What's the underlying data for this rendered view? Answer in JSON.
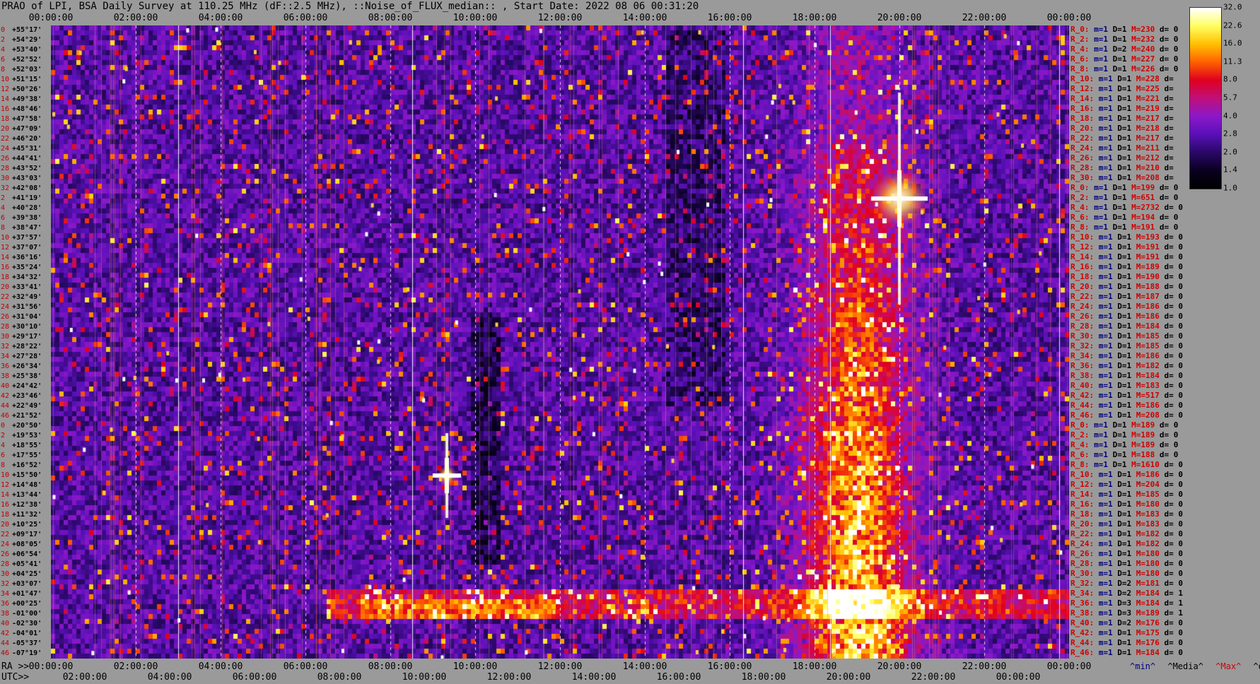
{
  "header": {
    "title": "PRAO of LPI, BSA Daily Survey at 110.25 MHz (dF::2.5 MHz), ::Noise_of_FLUX_median:: , Start Date: 2022 08 06 00:31:20"
  },
  "axes": {
    "ra_prefix": "RA >>",
    "utc_prefix": "UTC>>",
    "top_ticks": [
      "00:00:00",
      "02:00:00",
      "04:00:00",
      "06:00:00",
      "08:00:00",
      "10:00:00",
      "12:00:00",
      "14:00:00",
      "16:00:00",
      "18:00:00",
      "20:00:00",
      "22:00:00",
      "00:00:00"
    ],
    "ra_ticks": [
      "00:00:00",
      "02:00:00",
      "04:00:00",
      "06:00:00",
      "08:00:00",
      "10:00:00",
      "12:00:00",
      "14:00:00",
      "16:00:00",
      "18:00:00",
      "20:00:00",
      "22:00:00",
      "00:00:00"
    ],
    "utc_ticks": [
      "02:00:00",
      "04:00:00",
      "06:00:00",
      "08:00:00",
      "10:00:00",
      "12:00:00",
      "14:00:00",
      "16:00:00",
      "18:00:00",
      "20:00:00",
      "22:00:00",
      "00:00:00"
    ]
  },
  "rows": [
    {
      "idx": "0",
      "dec": "+55°17'"
    },
    {
      "idx": "2",
      "dec": "+54°29'"
    },
    {
      "idx": "4",
      "dec": "+53°40'"
    },
    {
      "idx": "6",
      "dec": "+52°52'"
    },
    {
      "idx": "8",
      "dec": "+52°03'"
    },
    {
      "idx": "10",
      "dec": "+51°15'"
    },
    {
      "idx": "12",
      "dec": "+50°26'"
    },
    {
      "idx": "14",
      "dec": "+49°38'"
    },
    {
      "idx": "16",
      "dec": "+48°46'"
    },
    {
      "idx": "18",
      "dec": "+47°58'"
    },
    {
      "idx": "20",
      "dec": "+47°09'"
    },
    {
      "idx": "22",
      "dec": "+46°20'"
    },
    {
      "idx": "24",
      "dec": "+45°31'"
    },
    {
      "idx": "26",
      "dec": "+44°41'"
    },
    {
      "idx": "28",
      "dec": "+43°52'"
    },
    {
      "idx": "30",
      "dec": "+43°03'"
    },
    {
      "idx": "32",
      "dec": "+42°08'"
    },
    {
      "idx": "2",
      "dec": "+41°19'"
    },
    {
      "idx": "4",
      "dec": "+40°28'"
    },
    {
      "idx": "6",
      "dec": "+39°38'"
    },
    {
      "idx": "8",
      "dec": "+38°47'"
    },
    {
      "idx": "10",
      "dec": "+37°57'"
    },
    {
      "idx": "12",
      "dec": "+37°07'"
    },
    {
      "idx": "14",
      "dec": "+36°16'"
    },
    {
      "idx": "16",
      "dec": "+35°24'"
    },
    {
      "idx": "18",
      "dec": "+34°32'"
    },
    {
      "idx": "20",
      "dec": "+33°41'"
    },
    {
      "idx": "22",
      "dec": "+32°49'"
    },
    {
      "idx": "24",
      "dec": "+31°56'"
    },
    {
      "idx": "26",
      "dec": "+31°04'"
    },
    {
      "idx": "28",
      "dec": "+30°10'"
    },
    {
      "idx": "30",
      "dec": "+29°17'"
    },
    {
      "idx": "32",
      "dec": "+28°22'"
    },
    {
      "idx": "34",
      "dec": "+27°28'"
    },
    {
      "idx": "36",
      "dec": "+26°34'"
    },
    {
      "idx": "38",
      "dec": "+25°38'"
    },
    {
      "idx": "40",
      "dec": "+24°42'"
    },
    {
      "idx": "42",
      "dec": "+23°46'"
    },
    {
      "idx": "44",
      "dec": "+22°49'"
    },
    {
      "idx": "46",
      "dec": "+21°52'"
    },
    {
      "idx": "0",
      "dec": "+20°50'"
    },
    {
      "idx": "2",
      "dec": "+19°53'"
    },
    {
      "idx": "4",
      "dec": "+18°55'"
    },
    {
      "idx": "6",
      "dec": "+17°55'"
    },
    {
      "idx": "8",
      "dec": "+16°52'"
    },
    {
      "idx": "10",
      "dec": "+15°50'"
    },
    {
      "idx": "12",
      "dec": "+14°48'"
    },
    {
      "idx": "14",
      "dec": "+13°44'"
    },
    {
      "idx": "16",
      "dec": "+12°38'"
    },
    {
      "idx": "18",
      "dec": "+11°32'"
    },
    {
      "idx": "20",
      "dec": "+10°25'"
    },
    {
      "idx": "22",
      "dec": "+09°17'"
    },
    {
      "idx": "24",
      "dec": "+08°05'"
    },
    {
      "idx": "26",
      "dec": "+06°54'"
    },
    {
      "idx": "28",
      "dec": "+05°41'"
    },
    {
      "idx": "30",
      "dec": "+04°25'"
    },
    {
      "idx": "32",
      "dec": "+03°07'"
    },
    {
      "idx": "34",
      "dec": "+01°47'"
    },
    {
      "idx": "36",
      "dec": "+00°25'"
    },
    {
      "idx": "38",
      "dec": "-01°00'"
    },
    {
      "idx": "40",
      "dec": "-02°30'"
    },
    {
      "idx": "42",
      "dec": "-04°01'"
    },
    {
      "idx": "44",
      "dec": "-05°37'"
    },
    {
      "idx": "46",
      "dec": "-07°19'"
    }
  ],
  "stats": [
    {
      "r": "R_0:",
      "m": "m=1",
      "d": "D=1",
      "M": "M=230",
      "dv": "d= 0"
    },
    {
      "r": "R_2:",
      "m": "m=1",
      "d": "D=1",
      "M": "M=232",
      "dv": "d= 0"
    },
    {
      "r": "R_4:",
      "m": "m=1",
      "d": "D=2",
      "M": "M=240",
      "dv": "d= 0"
    },
    {
      "r": "R_6:",
      "m": "m=1",
      "d": "D=1",
      "M": "M=227",
      "dv": "d= 0"
    },
    {
      "r": "R_8:",
      "m": "m=1",
      "d": "D=1",
      "M": "M=226",
      "dv": "d= 0"
    },
    {
      "r": "R_10:",
      "m": "m=1",
      "d": "D=1",
      "M": "M=228",
      "dv": "d="
    },
    {
      "r": "R_12:",
      "m": "m=1",
      "d": "D=1",
      "M": "M=225",
      "dv": "d="
    },
    {
      "r": "R_14:",
      "m": "m=1",
      "d": "D=1",
      "M": "M=221",
      "dv": "d="
    },
    {
      "r": "R_16:",
      "m": "m=1",
      "d": "D=1",
      "M": "M=219",
      "dv": "d="
    },
    {
      "r": "R_18:",
      "m": "m=1",
      "d": "D=1",
      "M": "M=217",
      "dv": "d="
    },
    {
      "r": "R_20:",
      "m": "m=1",
      "d": "D=1",
      "M": "M=218",
      "dv": "d="
    },
    {
      "r": "R_22:",
      "m": "m=1",
      "d": "D=1",
      "M": "M=217",
      "dv": "d="
    },
    {
      "r": "R_24:",
      "m": "m=1",
      "d": "D=1",
      "M": "M=211",
      "dv": "d="
    },
    {
      "r": "R_26:",
      "m": "m=1",
      "d": "D=1",
      "M": "M=212",
      "dv": "d="
    },
    {
      "r": "R_28:",
      "m": "m=1",
      "d": "D=1",
      "M": "M=210",
      "dv": "d="
    },
    {
      "r": "R_30:",
      "m": "m=1",
      "d": "D=1",
      "M": "M=208",
      "dv": "d="
    },
    {
      "r": "R_0:",
      "m": "m=1",
      "d": "D=1",
      "M": "M=199",
      "dv": "d= 0"
    },
    {
      "r": "R_2:",
      "m": "m=1",
      "d": "D=1",
      "M": "M=651",
      "dv": "d= 0"
    },
    {
      "r": "R_4:",
      "m": "m=1",
      "d": "D=1",
      "M": "M=2732",
      "dv": "d= 0"
    },
    {
      "r": "R_6:",
      "m": "m=1",
      "d": "D=1",
      "M": "M=194",
      "dv": "d= 0"
    },
    {
      "r": "R_8:",
      "m": "m=1",
      "d": "D=1",
      "M": "M=191",
      "dv": "d= 0"
    },
    {
      "r": "R_10:",
      "m": "m=1",
      "d": "D=1",
      "M": "M=193",
      "dv": "d= 0"
    },
    {
      "r": "R_12:",
      "m": "m=1",
      "d": "D=1",
      "M": "M=191",
      "dv": "d= 0"
    },
    {
      "r": "R_14:",
      "m": "m=1",
      "d": "D=1",
      "M": "M=191",
      "dv": "d= 0"
    },
    {
      "r": "R_16:",
      "m": "m=1",
      "d": "D=1",
      "M": "M=189",
      "dv": "d= 0"
    },
    {
      "r": "R_18:",
      "m": "m=1",
      "d": "D=1",
      "M": "M=190",
      "dv": "d= 0"
    },
    {
      "r": "R_20:",
      "m": "m=1",
      "d": "D=1",
      "M": "M=188",
      "dv": "d= 0"
    },
    {
      "r": "R_22:",
      "m": "m=1",
      "d": "D=1",
      "M": "M=187",
      "dv": "d= 0"
    },
    {
      "r": "R_24:",
      "m": "m=1",
      "d": "D=1",
      "M": "M=186",
      "dv": "d= 0"
    },
    {
      "r": "R_26:",
      "m": "m=1",
      "d": "D=1",
      "M": "M=186",
      "dv": "d= 0"
    },
    {
      "r": "R_28:",
      "m": "m=1",
      "d": "D=1",
      "M": "M=184",
      "dv": "d= 0"
    },
    {
      "r": "R_30:",
      "m": "m=1",
      "d": "D=1",
      "M": "M=185",
      "dv": "d= 0"
    },
    {
      "r": "R_32:",
      "m": "m=1",
      "d": "D=1",
      "M": "M=185",
      "dv": "d= 0"
    },
    {
      "r": "R_34:",
      "m": "m=1",
      "d": "D=1",
      "M": "M=186",
      "dv": "d= 0"
    },
    {
      "r": "R_36:",
      "m": "m=1",
      "d": "D=1",
      "M": "M=182",
      "dv": "d= 0"
    },
    {
      "r": "R_38:",
      "m": "m=1",
      "d": "D=1",
      "M": "M=184",
      "dv": "d= 0"
    },
    {
      "r": "R_40:",
      "m": "m=1",
      "d": "D=1",
      "M": "M=183",
      "dv": "d= 0"
    },
    {
      "r": "R_42:",
      "m": "m=1",
      "d": "D=1",
      "M": "M=517",
      "dv": "d= 0"
    },
    {
      "r": "R_44:",
      "m": "m=1",
      "d": "D=1",
      "M": "M=186",
      "dv": "d= 0"
    },
    {
      "r": "R_46:",
      "m": "m=1",
      "d": "D=1",
      "M": "M=208",
      "dv": "d= 0"
    },
    {
      "r": "R_0:",
      "m": "m=1",
      "d": "D=1",
      "M": "M=189",
      "dv": "d= 0"
    },
    {
      "r": "R_2:",
      "m": "m=1",
      "d": "D=1",
      "M": "M=189",
      "dv": "d= 0"
    },
    {
      "r": "R_4:",
      "m": "m=1",
      "d": "D=1",
      "M": "M=189",
      "dv": "d= 0"
    },
    {
      "r": "R_6:",
      "m": "m=1",
      "d": "D=1",
      "M": "M=188",
      "dv": "d= 0"
    },
    {
      "r": "R_8:",
      "m": "m=1",
      "d": "D=1",
      "M": "M=1610",
      "dv": "d= 0"
    },
    {
      "r": "R_10:",
      "m": "m=1",
      "d": "D=1",
      "M": "M=186",
      "dv": "d= 0"
    },
    {
      "r": "R_12:",
      "m": "m=1",
      "d": "D=1",
      "M": "M=204",
      "dv": "d= 0"
    },
    {
      "r": "R_14:",
      "m": "m=1",
      "d": "D=1",
      "M": "M=185",
      "dv": "d= 0"
    },
    {
      "r": "R_16:",
      "m": "m=1",
      "d": "D=1",
      "M": "M=180",
      "dv": "d= 0"
    },
    {
      "r": "R_18:",
      "m": "m=1",
      "d": "D=1",
      "M": "M=183",
      "dv": "d= 0"
    },
    {
      "r": "R_20:",
      "m": "m=1",
      "d": "D=1",
      "M": "M=183",
      "dv": "d= 0"
    },
    {
      "r": "R_22:",
      "m": "m=1",
      "d": "D=1",
      "M": "M=182",
      "dv": "d= 0"
    },
    {
      "r": "R_24:",
      "m": "m=1",
      "d": "D=1",
      "M": "M=182",
      "dv": "d= 0"
    },
    {
      "r": "R_26:",
      "m": "m=1",
      "d": "D=1",
      "M": "M=180",
      "dv": "d= 0"
    },
    {
      "r": "R_28:",
      "m": "m=1",
      "d": "D=1",
      "M": "M=180",
      "dv": "d= 0"
    },
    {
      "r": "R_30:",
      "m": "m=1",
      "d": "D=1",
      "M": "M=180",
      "dv": "d= 0"
    },
    {
      "r": "R_32:",
      "m": "m=1",
      "d": "D=2",
      "M": "M=181",
      "dv": "d= 0"
    },
    {
      "r": "R_34:",
      "m": "m=1",
      "d": "D=2",
      "M": "M=184",
      "dv": "d= 1"
    },
    {
      "r": "R_36:",
      "m": "m=1",
      "d": "D=3",
      "M": "M=184",
      "dv": "d= 1"
    },
    {
      "r": "R_38:",
      "m": "m=1",
      "d": "D=3",
      "M": "M=189",
      "dv": "d= 1"
    },
    {
      "r": "R_40:",
      "m": "m=1",
      "d": "D=2",
      "M": "M=176",
      "dv": "d= 0"
    },
    {
      "r": "R_42:",
      "m": "m=1",
      "d": "D=1",
      "M": "M=175",
      "dv": "d= 0"
    },
    {
      "r": "R_44:",
      "m": "m=1",
      "d": "D=1",
      "M": "M=176",
      "dv": "d= 0"
    },
    {
      "r": "R_46:",
      "m": "m=1",
      "d": "D=1",
      "M": "M=184",
      "dv": "d= 0"
    }
  ],
  "legend": {
    "min": "^min^",
    "median": "^Media^",
    "max": "^Max^",
    "devia": "^devia^",
    "min_color": "#000080",
    "median_color": "#000000",
    "max_color": "#d00000",
    "devia_color": "#000000"
  },
  "colorbar": {
    "ticks": [
      "32.0",
      "22.6",
      "16.0",
      "11.3",
      "8.0",
      "5.7",
      "4.0",
      "2.8",
      "2.0",
      "1.4",
      "1.0"
    ],
    "colormap": [
      "#ffffff",
      "#ffff60",
      "#ffc000",
      "#ff6000",
      "#e00020",
      "#c0107a",
      "#8c18c8",
      "#5a10b8",
      "#2a0868",
      "#0a0020",
      "#000000"
    ]
  },
  "chart_data": {
    "type": "heatmap",
    "title": "PRAO of LPI, BSA Daily Survey at 110.25 MHz (dF::2.5 MHz), ::Noise_of_FLUX_median:: , Start Date: 2022 08 06 00:31:20",
    "x_axis": "RA / UTC (hours)",
    "xlim": [
      "00:00:00",
      "24:00:00"
    ],
    "y_axis": "Declination",
    "ylim": [
      "+55°17'",
      "-07°19'"
    ],
    "color_scale": "log",
    "color_range": [
      1.0,
      32.0
    ],
    "features": [
      {
        "type": "point-source",
        "ra": "09:20:00",
        "dec": "+15°50'",
        "level": "high"
      },
      {
        "type": "point-source",
        "ra": "20:00:00",
        "dec": "+41°19'",
        "level": "saturated"
      },
      {
        "type": "broad-emission",
        "ra_range": [
          "18:30:00",
          "21:30:00"
        ],
        "dec_range": [
          "-07°19'",
          "+50°26'"
        ]
      },
      {
        "type": "horizontal-band",
        "dec_range": [
          "+01°47'",
          "-01°00'"
        ],
        "ra_range": [
          "07:00:00",
          "24:00:00"
        ]
      }
    ]
  }
}
